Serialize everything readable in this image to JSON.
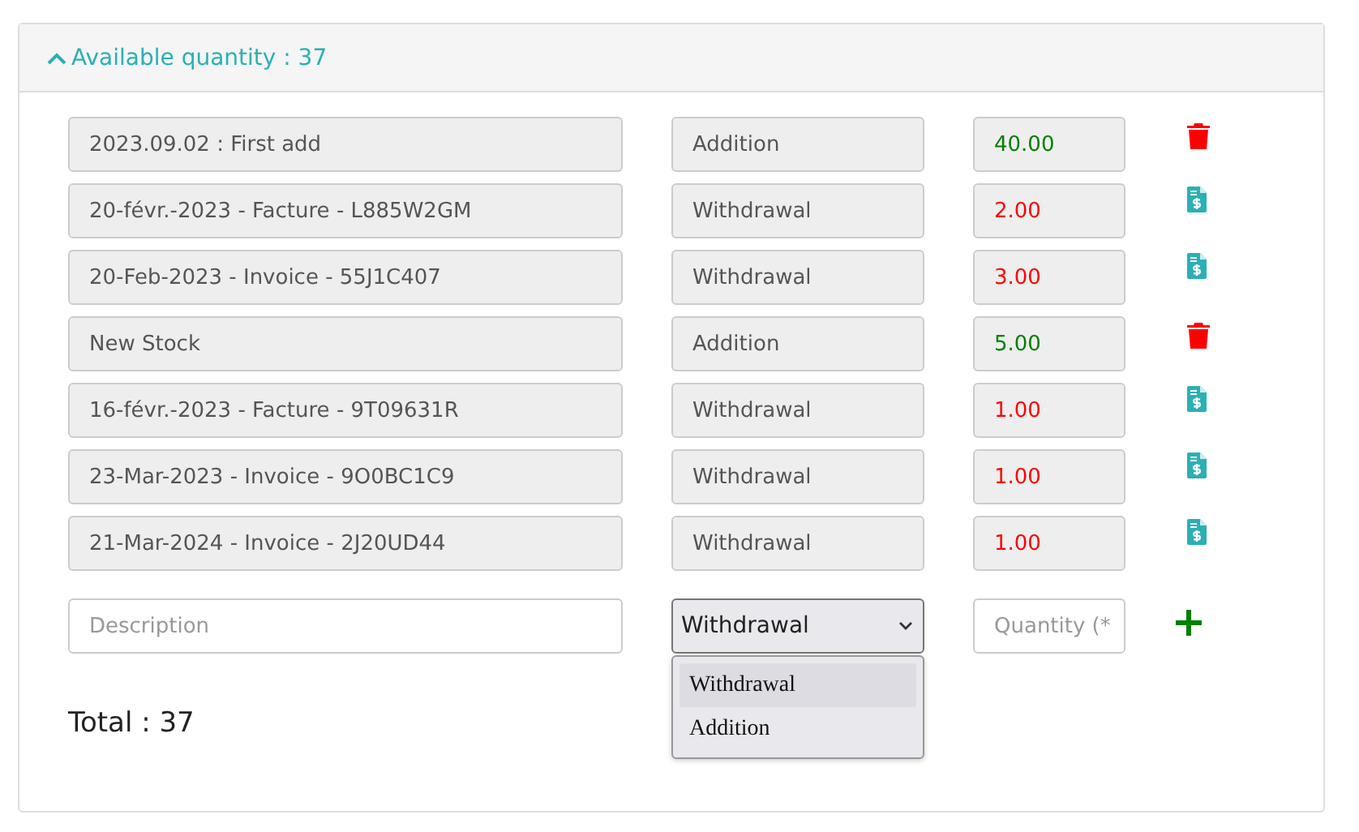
{
  "header": {
    "title": "Available quantity : 37",
    "expanded": true
  },
  "entries": [
    {
      "description": "2023.09.02 : First add",
      "type": "Addition",
      "quantity": "40.00",
      "kind": "addition"
    },
    {
      "description": "20-févr.-2023 - Facture - L885W2GM",
      "type": "Withdrawal",
      "quantity": "2.00",
      "kind": "withdrawal"
    },
    {
      "description": "20-Feb-2023 - Invoice - 55J1C407",
      "type": "Withdrawal",
      "quantity": "3.00",
      "kind": "withdrawal"
    },
    {
      "description": "New Stock",
      "type": "Addition",
      "quantity": "5.00",
      "kind": "addition"
    },
    {
      "description": "16-févr.-2023 - Facture - 9T09631R",
      "type": "Withdrawal",
      "quantity": "1.00",
      "kind": "withdrawal"
    },
    {
      "description": "23-Mar-2023 - Invoice - 9O0BC1C9",
      "type": "Withdrawal",
      "quantity": "1.00",
      "kind": "withdrawal"
    },
    {
      "description": "21-Mar-2024 - Invoice - 2J20UD44",
      "type": "Withdrawal",
      "quantity": "1.00",
      "kind": "withdrawal"
    }
  ],
  "new_entry": {
    "description_placeholder": "Description",
    "type_value": "Withdrawal",
    "quantity_placeholder": "Quantity (*",
    "type_options": [
      {
        "label": "Withdrawal",
        "selected": true
      },
      {
        "label": "Addition",
        "selected": false
      }
    ]
  },
  "total": "Total : 37"
}
